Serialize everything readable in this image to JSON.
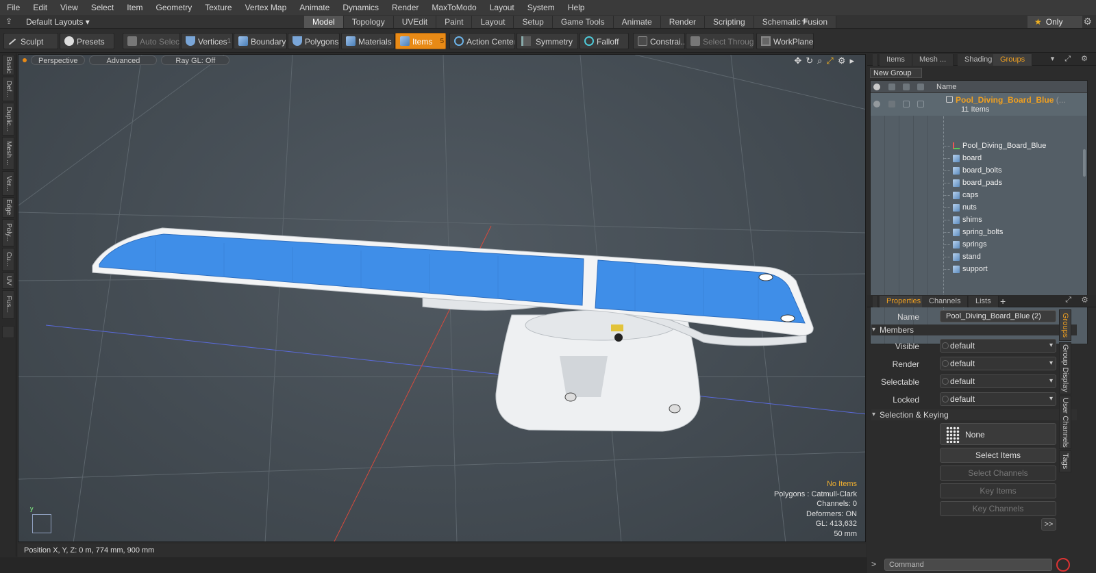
{
  "menu": [
    "File",
    "Edit",
    "View",
    "Select",
    "Item",
    "Geometry",
    "Texture",
    "Vertex Map",
    "Animate",
    "Dynamics",
    "Render",
    "MaxToModo",
    "Layout",
    "System",
    "Help"
  ],
  "layout": {
    "default_layouts": "Default Layouts ▾",
    "tabs": [
      "Model",
      "Topology",
      "UVEdit",
      "Paint",
      "Layout",
      "Setup",
      "Game Tools",
      "Animate",
      "Render",
      "Scripting",
      "Schematic Fusion"
    ],
    "active_tab": "Model",
    "only_label": "Only"
  },
  "toolbar": {
    "sculpt": "Sculpt",
    "presets": "Presets",
    "auto_select": "Auto Select",
    "vertices": "Vertices",
    "vertices_key": "1",
    "boundary": "Boundary",
    "polygons": "Polygons",
    "materials": "Materials",
    "items": "Items",
    "items_key": "5",
    "action_center": "Action Center",
    "symmetry": "Symmetry",
    "falloff": "Falloff",
    "constraints": "Constrai...",
    "select_through": "Select Through",
    "workplane": "WorkPlane"
  },
  "left_tabs": [
    "Basic",
    "Def...",
    "Duplic...",
    "Mesh ...",
    "Ver...",
    "Edge",
    "Poly...",
    "Cu...",
    "UV",
    "Fus..."
  ],
  "viewport": {
    "perspective": "Perspective",
    "advanced": "Advanced",
    "raygl": "Ray GL: Off",
    "info": {
      "no_items": "No Items",
      "polygons": "Polygons : Catmull-Clark",
      "channels": "Channels: 0",
      "deformers": "Deformers: ON",
      "gl": "GL: 413,632",
      "scale": "50 mm"
    },
    "axis_label": "y"
  },
  "status": {
    "position": "Position X, Y, Z:   0 m, 774 mm, 900 mm"
  },
  "right_tabs": [
    "Items",
    "Mesh ...",
    "Shading",
    "Groups"
  ],
  "active_right_tab": "Groups",
  "groups": {
    "new_group": "New Group",
    "name_header": "Name",
    "group_name": "Pool_Diving_Board_Blue",
    "group_suffix": " (...",
    "group_count": "11 Items",
    "items": [
      "Pool_Diving_Board_Blue",
      "board",
      "board_bolts",
      "board_pads",
      "caps",
      "nuts",
      "shims",
      "spring_bolts",
      "springs",
      "stand",
      "support"
    ]
  },
  "prop_tabs": [
    "Properties",
    "Channels",
    "Lists"
  ],
  "properties": {
    "name_label": "Name",
    "name_value": "Pool_Diving_Board_Blue (2)",
    "members_section": "Members",
    "visible_label": "Visible",
    "visible_value": "default",
    "render_label": "Render",
    "render_value": "default",
    "selectable_label": "Selectable",
    "selectable_value": "default",
    "locked_label": "Locked",
    "locked_value": "default",
    "selection_section": "Selection & Keying",
    "none_label": "None",
    "select_items": "Select Items",
    "select_channels": "Select Channels",
    "key_items": "Key Items",
    "key_channels": "Key Channels",
    "more": ">>"
  },
  "prop_vtabs": [
    "Groups",
    "Group Display",
    "User Channels",
    "Tags"
  ],
  "command": {
    "placeholder": "Command"
  },
  "colors": {
    "accent": "#e88a16",
    "board_blue": "#3f8ee8",
    "highlight_text": "#f0a020"
  }
}
